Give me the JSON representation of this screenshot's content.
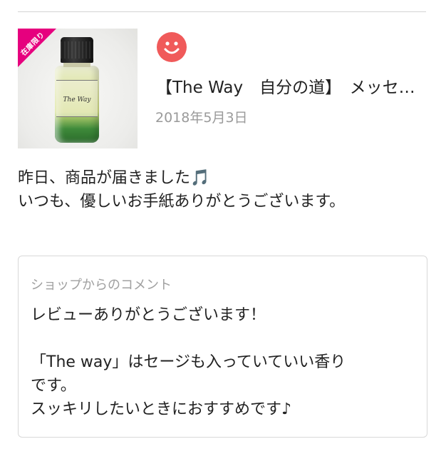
{
  "product": {
    "ribbon_label": "在庫限り",
    "bottle_label": "The Way",
    "title": "【The Way　自分の道】　メッセージ",
    "avatar_icon": "smiley-face-icon",
    "avatar_color": "#f05a5a"
  },
  "review": {
    "date": "2018年5月3日",
    "lines": [
      "昨日、商品が届きました🎵",
      "いつも、優しいお手紙ありがとうございます。"
    ]
  },
  "shop_comment": {
    "heading": "ショップからのコメント",
    "lines": [
      "レビューありがとうございます！",
      "",
      "「The way」はセージも入っていていい香り",
      "です。",
      "スッキリしたいときにおすすめです♪"
    ]
  }
}
